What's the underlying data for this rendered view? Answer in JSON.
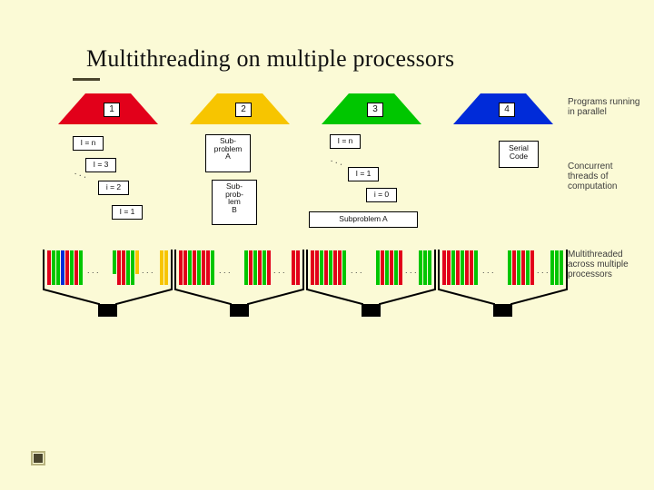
{
  "title": "Multithreading on multiple processors",
  "programs": [
    {
      "num": "1",
      "color": "#e2001a"
    },
    {
      "num": "2",
      "color": "#f7c500"
    },
    {
      "num": "3",
      "color": "#00c600"
    },
    {
      "num": "4",
      "color": "#002bd9"
    }
  ],
  "legend": {
    "row1": "Programs running in parallel",
    "row2": "Concurrent threads of computation",
    "row3": "Multithreaded across multiple processors"
  },
  "threads": {
    "col1": [
      "I = n",
      "I = 3",
      "i = 2",
      "I = 1"
    ],
    "col2": [
      "Sub-\nproblem\nA",
      "Sub-\nprob-\nlem\nB"
    ],
    "col3": [
      "I = n",
      "I = 1",
      "i = 0",
      "Subproblem A"
    ],
    "col4": [
      "Serial\nCode"
    ]
  },
  "dots": ". . ."
}
